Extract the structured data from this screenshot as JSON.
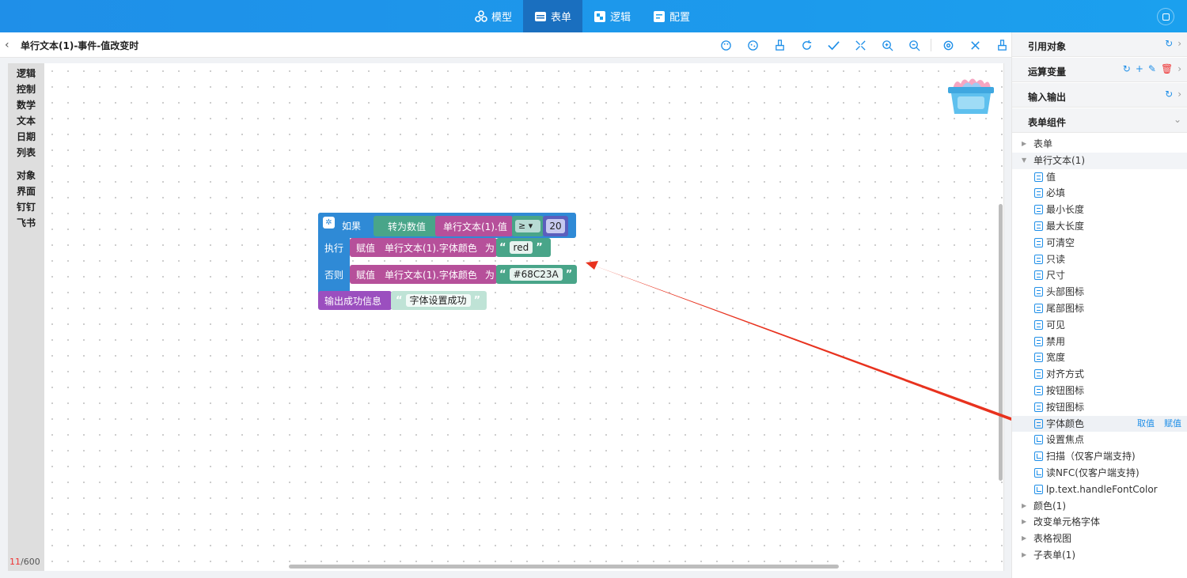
{
  "nav": {
    "items": [
      {
        "label": "模型",
        "icon": "model-icon"
      },
      {
        "label": "表单",
        "icon": "form-icon"
      },
      {
        "label": "逻辑",
        "icon": "logic-icon"
      },
      {
        "label": "配置",
        "icon": "config-icon"
      }
    ],
    "active_index": 1
  },
  "titlebar": {
    "title": "单行文本(1)-事件-值改变时"
  },
  "categories": {
    "group1": [
      "逻辑",
      "控制",
      "数学",
      "文本",
      "日期",
      "列表"
    ],
    "group2": [
      "对象",
      "界面",
      "钉钉",
      "飞书"
    ]
  },
  "counter": {
    "current": "11",
    "total": "/600"
  },
  "blocks": {
    "if_label": "如果",
    "convert_label": "转为数值",
    "value_ref": "单行文本(1).值",
    "compare_op": "≥ ▾",
    "compare_number": "20",
    "then_label": "执行",
    "else_label": "否则",
    "assign_label": "赋值",
    "assign_target": "单行文本(1).字体颜色",
    "as_label": "为",
    "then_value": "red",
    "else_value": "#68C23A",
    "output_label": "输出成功信息",
    "output_value": "字体设置成功",
    "open_quote": "“",
    "close_quote": "”"
  },
  "panel": {
    "sections": [
      {
        "title": "引用对象"
      },
      {
        "title": "运算变量"
      },
      {
        "title": "输入输出"
      },
      {
        "title": "表单组件"
      }
    ],
    "tree": {
      "form": "表单",
      "single_text": "单行文本(1)",
      "props": [
        "值",
        "必填",
        "最小长度",
        "最大长度",
        "可清空",
        "只读",
        "尺寸",
        "头部图标",
        "尾部图标",
        "可见",
        "禁用",
        "宽度",
        "对齐方式",
        "按钮图标",
        "按钮图标",
        "字体颜色"
      ],
      "methods": [
        "设置焦点",
        "扫描（仅客户端支持)",
        "读NFC(仅客户端支持)",
        "lp.text.handleFontColor"
      ],
      "hover_actions": {
        "get": "取值",
        "set": "赋值"
      },
      "others": [
        "颜色(1)",
        "改变单元格字体",
        "表格视图",
        "子表单(1)"
      ]
    }
  },
  "colors": {
    "accent": "#1f8fe8",
    "logic_block": "#2f8ad6",
    "text_block": "#49a589",
    "var_block": "#b6509a",
    "arrow": "#e8321e"
  }
}
